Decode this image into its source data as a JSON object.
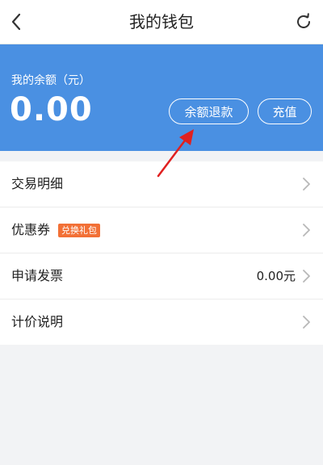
{
  "header": {
    "title": "我的钱包",
    "back_icon": "chevron-left-icon",
    "refresh_icon": "refresh-icon"
  },
  "balance": {
    "label": "我的余额（元）",
    "amount": "0.00",
    "refund_label": "余额退款",
    "recharge_label": "充值",
    "background_color": "#4a90e2"
  },
  "list": {
    "items": [
      {
        "label": "交易明细"
      },
      {
        "label": "优惠券",
        "badge": "兑换礼包",
        "badge_color": "#f27036"
      },
      {
        "label": "申请发票",
        "value": "0.00元"
      },
      {
        "label": "计价说明"
      }
    ]
  },
  "annotation": {
    "arrow_color": "#e02020"
  }
}
